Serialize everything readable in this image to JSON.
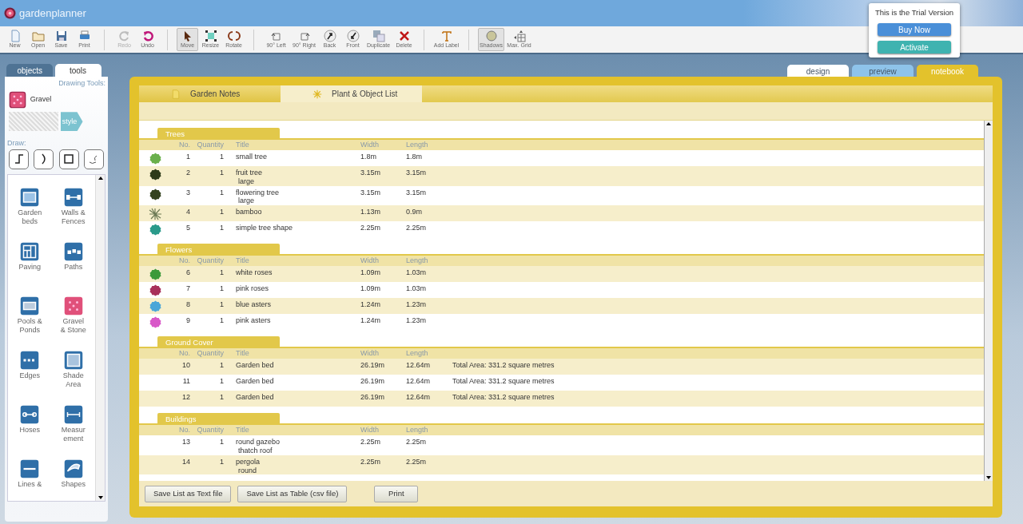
{
  "app": {
    "name": "gardenplanner"
  },
  "toolbar": {
    "groups": [
      [
        {
          "label": "New",
          "disabled": false,
          "pressed": false
        },
        {
          "label": "Open",
          "disabled": false,
          "pressed": false
        },
        {
          "label": "Save",
          "disabled": false,
          "pressed": false
        },
        {
          "label": "Print",
          "disabled": false,
          "pressed": false
        }
      ],
      [
        {
          "label": "Redo",
          "disabled": true,
          "pressed": false
        },
        {
          "label": "Undo",
          "disabled": false,
          "pressed": false
        }
      ],
      [
        {
          "label": "Move",
          "disabled": false,
          "pressed": true
        },
        {
          "label": "Resize",
          "disabled": false,
          "pressed": false
        },
        {
          "label": "Rotate",
          "disabled": false,
          "pressed": false
        }
      ],
      [
        {
          "label": "90° Left",
          "disabled": false,
          "pressed": false
        },
        {
          "label": "90° Right",
          "disabled": false,
          "pressed": false
        },
        {
          "label": "Back",
          "disabled": false,
          "pressed": false
        },
        {
          "label": "Front",
          "disabled": false,
          "pressed": false
        },
        {
          "label": "Duplicate",
          "disabled": false,
          "pressed": false
        },
        {
          "label": "Delete",
          "disabled": false,
          "pressed": false
        }
      ],
      [
        {
          "label": "Add Label",
          "disabled": false,
          "pressed": false
        }
      ],
      [
        {
          "label": "Shadows",
          "disabled": false,
          "pressed": true
        },
        {
          "label": "Max. Grid",
          "disabled": false,
          "pressed": false
        }
      ]
    ]
  },
  "trial": {
    "message": "This is the Trial Version",
    "buttons": [
      {
        "label": "Buy Now",
        "color": "#4a8fd8"
      },
      {
        "label": "Activate",
        "color": "#3fb3b0"
      }
    ]
  },
  "view_tabs": [
    {
      "label": "design",
      "selected": false,
      "color": "#ffffff"
    },
    {
      "label": "preview",
      "selected": false,
      "color": "#8ec3ea"
    },
    {
      "label": "notebook",
      "selected": true,
      "color": "#e3c22c"
    }
  ],
  "left_panel": {
    "tabs": [
      {
        "label": "objects",
        "selected": false
      },
      {
        "label": "tools",
        "selected": true
      }
    ],
    "heading": "Drawing Tools:",
    "current_tool": "Gravel",
    "style_button": "style",
    "draw_label": "Draw:",
    "objects": [
      {
        "lines": [
          "Garden",
          "beds"
        ]
      },
      {
        "lines": [
          "Walls &",
          "Fences"
        ]
      },
      {
        "lines": [
          "Paving"
        ]
      },
      {
        "lines": [
          "Paths"
        ]
      },
      {
        "lines": [
          "Pools &",
          "Ponds"
        ]
      },
      {
        "lines": [
          "Gravel",
          "& Stone"
        ]
      },
      {
        "lines": [
          "Edges"
        ]
      },
      {
        "lines": [
          "Shade",
          "Area"
        ]
      },
      {
        "lines": [
          "Hoses"
        ]
      },
      {
        "lines": [
          "Measur",
          "ement"
        ]
      },
      {
        "lines": [
          "Lines &"
        ]
      },
      {
        "lines": [
          "Shapes"
        ]
      }
    ]
  },
  "notebook": {
    "tabs": [
      {
        "label": "Garden Notes",
        "selected": false
      },
      {
        "label": "Plant & Object List",
        "selected": true
      }
    ],
    "sections": [
      {
        "title": "Trees",
        "columns": [
          "No.",
          "Quantity",
          "Title",
          "Width",
          "Length"
        ],
        "rows": [
          {
            "no": "1",
            "quantity": "1",
            "title": "small tree",
            "width": "1.8m",
            "length": "1.8m",
            "symbol": {
              "kind": "round",
              "color": "#6ab04c"
            }
          },
          {
            "no": "2",
            "quantity": "1",
            "title": "fruit tree",
            "subtitle": "large",
            "width": "3.15m",
            "length": "3.15m",
            "symbol": {
              "kind": "round",
              "color": "#2e3b1a"
            }
          },
          {
            "no": "3",
            "quantity": "1",
            "title": "flowering tree",
            "subtitle": "large",
            "width": "3.15m",
            "length": "3.15m",
            "symbol": {
              "kind": "round",
              "color": "#34431f"
            }
          },
          {
            "no": "4",
            "quantity": "1",
            "title": "bamboo",
            "width": "1.13m",
            "length": "0.9m",
            "symbol": {
              "kind": "spiky",
              "color": "#6d7a55"
            }
          },
          {
            "no": "5",
            "quantity": "1",
            "title": "simple tree shape",
            "width": "2.25m",
            "length": "2.25m",
            "symbol": {
              "kind": "round",
              "color": "#2a9a8a"
            }
          }
        ]
      },
      {
        "title": "Flowers",
        "columns": [
          "No.",
          "Quantity",
          "Title",
          "Width",
          "Length"
        ],
        "rows": [
          {
            "no": "6",
            "quantity": "1",
            "title": "white roses",
            "width": "1.09m",
            "length": "1.03m",
            "symbol": {
              "kind": "round",
              "color": "#3c9a3a"
            }
          },
          {
            "no": "7",
            "quantity": "1",
            "title": "pink roses",
            "width": "1.09m",
            "length": "1.03m",
            "symbol": {
              "kind": "round",
              "color": "#a8305a"
            }
          },
          {
            "no": "8",
            "quantity": "1",
            "title": "blue asters",
            "width": "1.24m",
            "length": "1.23m",
            "symbol": {
              "kind": "round",
              "color": "#4aa6d8"
            }
          },
          {
            "no": "9",
            "quantity": "1",
            "title": "pink asters",
            "width": "1.24m",
            "length": "1.23m",
            "symbol": {
              "kind": "round",
              "color": "#d858c8"
            }
          }
        ]
      },
      {
        "title": "Ground Cover",
        "columns": [
          "No.",
          "Quantity",
          "Title",
          "Width",
          "Length"
        ],
        "rows": [
          {
            "no": "10",
            "quantity": "1",
            "title": "Garden bed",
            "width": "26.19m",
            "length": "12.64m",
            "note": "Total Area: 331.2 square metres"
          },
          {
            "no": "11",
            "quantity": "1",
            "title": "Garden bed",
            "width": "26.19m",
            "length": "12.64m",
            "note": "Total Area: 331.2 square metres"
          },
          {
            "no": "12",
            "quantity": "1",
            "title": "Garden bed",
            "width": "26.19m",
            "length": "12.64m",
            "note": "Total Area: 331.2 square metres"
          }
        ]
      },
      {
        "title": "Buildings",
        "columns": [
          "No.",
          "Quantity",
          "Title",
          "Width",
          "Length"
        ],
        "rows": [
          {
            "no": "13",
            "quantity": "1",
            "title": "round gazebo",
            "subtitle": "thatch roof",
            "width": "2.25m",
            "length": "2.25m"
          },
          {
            "no": "14",
            "quantity": "1",
            "title": "pergola",
            "subtitle": "round",
            "width": "2.25m",
            "length": "2.25m"
          }
        ]
      }
    ],
    "buttons": [
      "Save List as Text file",
      "Save List as Table (csv file)",
      "Print"
    ]
  }
}
